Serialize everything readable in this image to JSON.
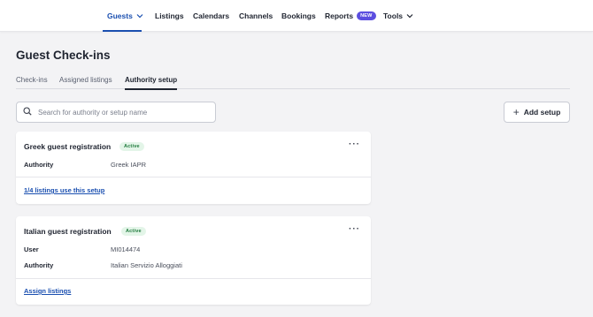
{
  "nav": {
    "guests": "Guests",
    "listings": "Listings",
    "calendars": "Calendars",
    "channels": "Channels",
    "bookings": "Bookings",
    "reports": "Reports",
    "reports_badge": "NEW",
    "tools": "Tools"
  },
  "page": {
    "title": "Guest Check-ins"
  },
  "tabs": {
    "checkins": "Check-ins",
    "assigned": "Assigned listings",
    "authority": "Authority setup"
  },
  "search": {
    "placeholder": "Search for authority or setup name"
  },
  "actions": {
    "add_setup": "Add setup"
  },
  "cards": [
    {
      "title": "Greek guest registration",
      "status": "Active",
      "rows": [
        {
          "label": "Authority",
          "value": "Greek IAPR"
        }
      ],
      "link": "1/4 listings use this setup"
    },
    {
      "title": "Italian guest registration",
      "status": "Active",
      "rows": [
        {
          "label": "User",
          "value": "MI014474"
        },
        {
          "label": "Authority",
          "value": "Italian Servizio Alloggiati"
        }
      ],
      "link": "Assign listings"
    }
  ],
  "colors": {
    "accent": "#1a4fb0",
    "badge_new": "#5b4ee0",
    "status_active_bg": "#e3f5e8",
    "status_active_text": "#1f7a3c",
    "dot": "#e0457b"
  }
}
